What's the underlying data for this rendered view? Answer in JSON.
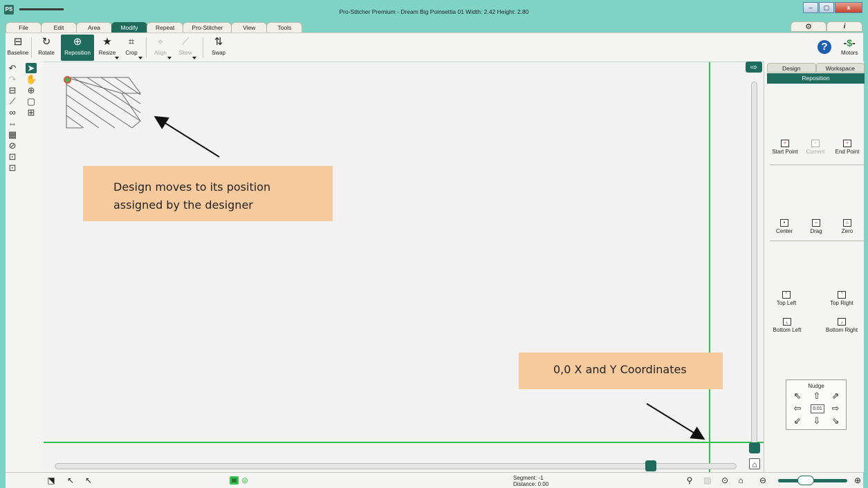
{
  "window": {
    "app_icon": "PS",
    "title": "Pro-Stitcher Premium  -  Dream Big Poinsettia 01  Width: 2.42  Height: 2.80",
    "controls": [
      "–",
      "▢",
      "x"
    ]
  },
  "menu_tabs": [
    "File",
    "Edit",
    "Area",
    "Modify",
    "Repeat",
    "Pro-Stitcher",
    "View",
    "Tools"
  ],
  "active_tab": "Modify",
  "toolbar": {
    "baseline": "Baseline",
    "rotate": "Rotate",
    "reposition": "Reposition",
    "resize": "Resize",
    "crop": "Crop",
    "align": "Align",
    "skew": "Skew",
    "swap": "Swap",
    "motors": "Motors"
  },
  "canvas": {
    "callout_top": [
      "Design moves to its position",
      "assigned by the designer"
    ],
    "callout_bottom": "0,0 X and Y Coordinates"
  },
  "right_panel": {
    "tabs": [
      "Design",
      "Workspace"
    ],
    "header": "Reposition",
    "points": [
      "Start Point",
      "Current",
      "End Point"
    ],
    "actions": [
      "Center",
      "Drag",
      "Zero"
    ],
    "corners": [
      "Top Left",
      "Top Right",
      "Bottom Left",
      "Bottom Right"
    ],
    "nudge_title": "Nudge",
    "nudge_value": "0.01"
  },
  "status": {
    "segment": "Segment: -1",
    "distance": "Distance: 0.00"
  },
  "colors": {
    "accent": "#1f6b5c",
    "title_bar": "#7fd3c4",
    "guide_line": "#35c14a",
    "callout": "#f6ca9c"
  }
}
